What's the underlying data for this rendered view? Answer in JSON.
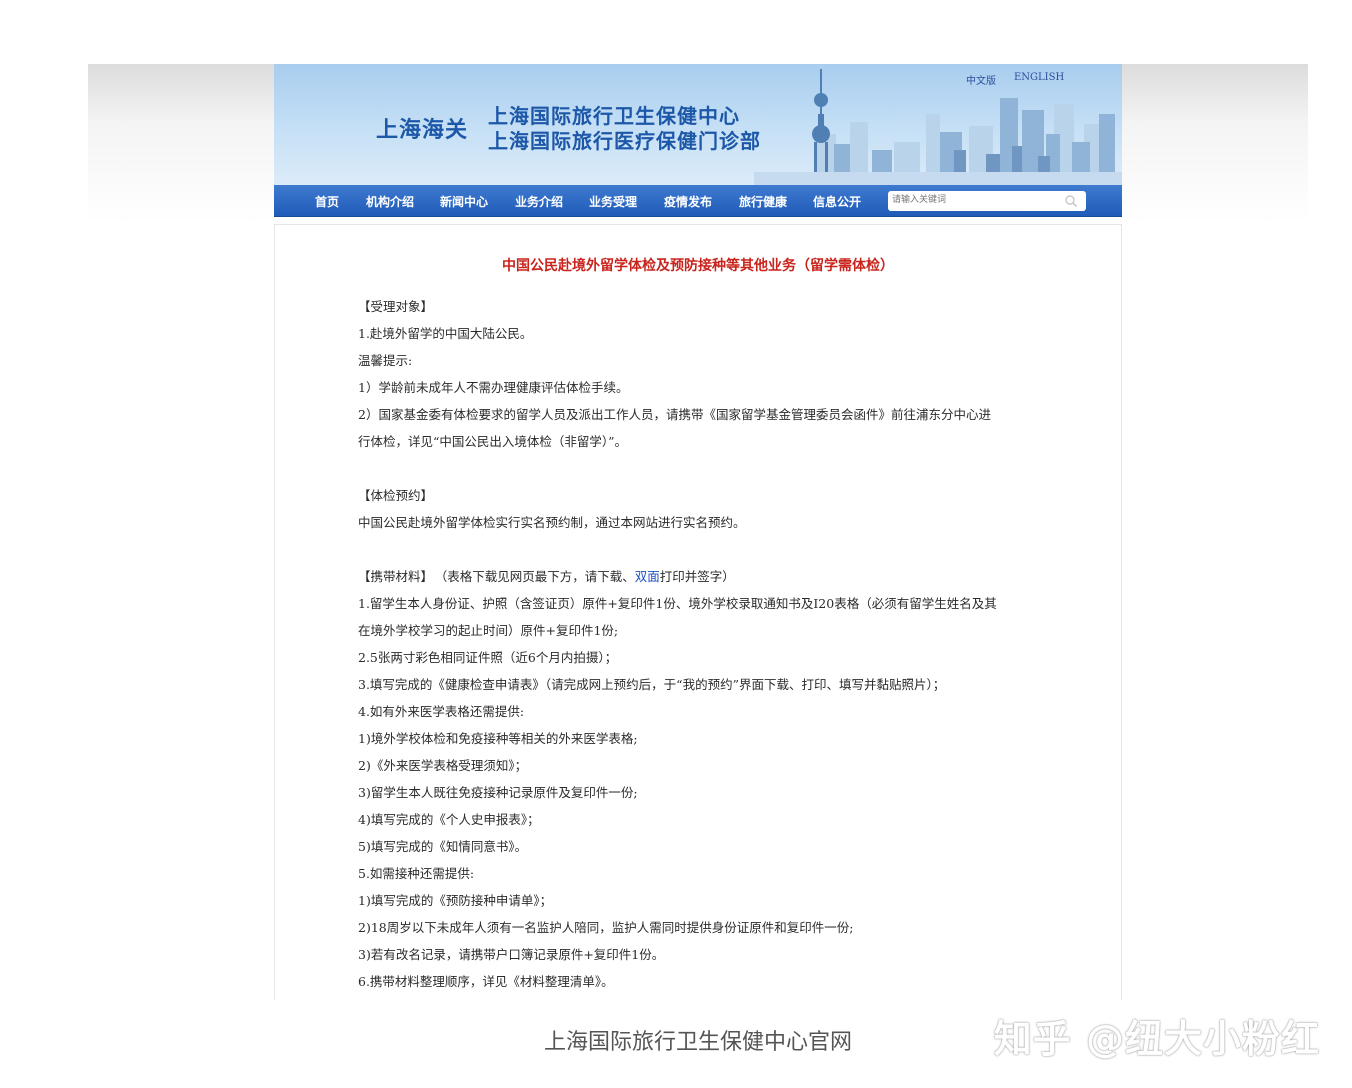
{
  "header": {
    "lang_cn": "中文版",
    "lang_en": "ENGLISH",
    "customs": "上海海关",
    "org_line1": "上海国际旅行卫生保健中心",
    "org_line2": "上海国际旅行医疗保健门诊部"
  },
  "nav": {
    "items": [
      "首页",
      "机构介绍",
      "新闻中心",
      "业务介绍",
      "业务受理",
      "疫情发布",
      "旅行健康",
      "信息公开"
    ],
    "search_placeholder": "请输入关键词"
  },
  "article": {
    "title": "中国公民赴境外留学体检及预防接种等其他业务（留学需体检）",
    "lines": [
      "【受理对象】",
      "1.赴境外留学的中国大陆公民。",
      "温馨提示:",
      "1）学龄前未成年人不需办理健康评估体检手续。",
      "2）国家基金委有体检要求的留学人员及派出工作人员，请携带《国家留学基金管理委员会函件》前往浦东分中心进",
      "行体检，详见“中国公民出入境体检（非留学）”。",
      "",
      "【体检预约】",
      "中国公民赴境外留学体检实行实名预约制，通过本网站进行实名预约。",
      "",
      "MATERIALS_HEADER",
      "1.留学生本人身份证、护照（含签证页）原件+复印件1份、境外学校录取通知书及I20表格（必须有留学生姓名及其",
      "在境外学校学习的起止时间）原件+复印件1份;",
      "2.5张两寸彩色相同证件照（近6个月内拍摄）；",
      "3.填写完成的《健康检查申请表》（请完成网上预约后，于“我的预约”界面下载、打印、填写并黏贴照片）；",
      "4.如有外来医学表格还需提供:",
      "1)境外学校体检和免疫接种等相关的外来医学表格;",
      "2)《外来医学表格受理须知》；",
      "3)留学生本人既往免疫接种记录原件及复印件一份;",
      "4)填写完成的《个人史申报表》；",
      "5)填写完成的《知情同意书》。",
      "5.如需接种还需提供:",
      "1)填写完成的《预防接种申请单》；",
      "2)18周岁以下未成年人须有一名监护人陪同，监护人需同时提供身份证原件和复印件一份;",
      "3)若有改名记录，请携带户口簿记录原件+复印件1份。",
      "6.携带材料整理顺序，详见《材料整理清单》。"
    ],
    "materials": {
      "heading": "【携带材料】",
      "note_before": "（表格下载见网页最下方，请下载、",
      "note_highlight": "双面",
      "note_after": "打印并签字）"
    }
  },
  "caption": "上海国际旅行卫生保健中心官网",
  "watermark": "知乎 @纽大小粉红"
}
